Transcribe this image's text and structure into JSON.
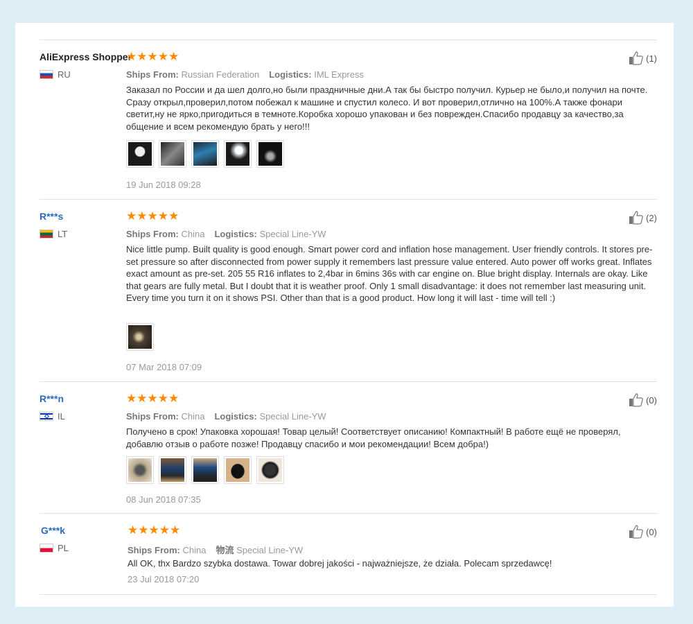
{
  "reviews": [
    {
      "user": "AliExpress Shopper",
      "country": "RU",
      "stars": "★★★★★",
      "ships_label": "Ships From:",
      "ships_from": "Russian Federation",
      "logistics_label": "Logistics:",
      "logistics": "IML Express",
      "text": "Заказал по России и да шел долго,но были праздничные дни.А так бы быстро получил. Курьер не было,и получил на почте. Сразу открыл,проверил,потом побежал к машине и спустил колесо. И вот проверил,отлично на 100%.А также фонари светит,ну не ярко,пригодиться в темноте.Коробка хорошо упакован и без поврежден.Спасибо продавцу за качество,за общение и всем рекомендую брать у него!!!",
      "date": "19 Jun 2018 09:28",
      "helpful": "(1)"
    },
    {
      "user": "R***s",
      "country": "LT",
      "stars": "★★★★★",
      "ships_label": "Ships From:",
      "ships_from": "China",
      "logistics_label": "Logistics:",
      "logistics": "Special Line-YW",
      "text": "Nice little pump. Built quality is good enough. Smart power cord and inflation hose management. User friendly controls. It stores pre-set pressure so after disconnected from power supply it remembers last pressure value entered. Auto power off works great. Inflates exact amount as pre-set. 205 55 R16 inflates to 2,4bar in 6mins 36s with car engine on. Blue bright display. Internals are okay. Like that gears are fully metal. But I doubt that it is weather proof. Only 1 small disadvantage: it does not remember last measuring unit. Every time you turn it on it shows PSI. Other than that is a good product. How long it will last - time will tell :)",
      "date": "07 Mar 2018 07:09",
      "helpful": "(2)"
    },
    {
      "user": "R***n",
      "country": "IL",
      "stars": "★★★★★",
      "ships_label": "Ships From:",
      "ships_from": "China",
      "logistics_label": "Logistics:",
      "logistics": "Special Line-YW",
      "text": "Получено в срок! Упаковка хорошая! Товар целый! Соответствует описанию! Компактный! В работе ещё не проверял, добавлю отзыв о работе позже! Продавцу спасибо и мои рекомендации! Всем добра!)",
      "date": "08 Jun 2018 07:35",
      "helpful": "(0)"
    },
    {
      "user": "G***k",
      "country": "PL",
      "stars": "★★★★★",
      "ships_label": "Ships From:",
      "ships_from": "China",
      "logistics_label": "物流",
      "logistics": "Special Line-YW",
      "text": "All OK, thx Bardzo szybka dostawa. Towar dobrej jakości - najważniejsze, że działa. Polecam sprzedawcę!",
      "date": "23 Jul 2018 07:20",
      "helpful": "(0)"
    }
  ],
  "colors": {
    "star": "#ff8a00",
    "masked_user": "#2a6bbf",
    "background": "#ddeef7"
  }
}
